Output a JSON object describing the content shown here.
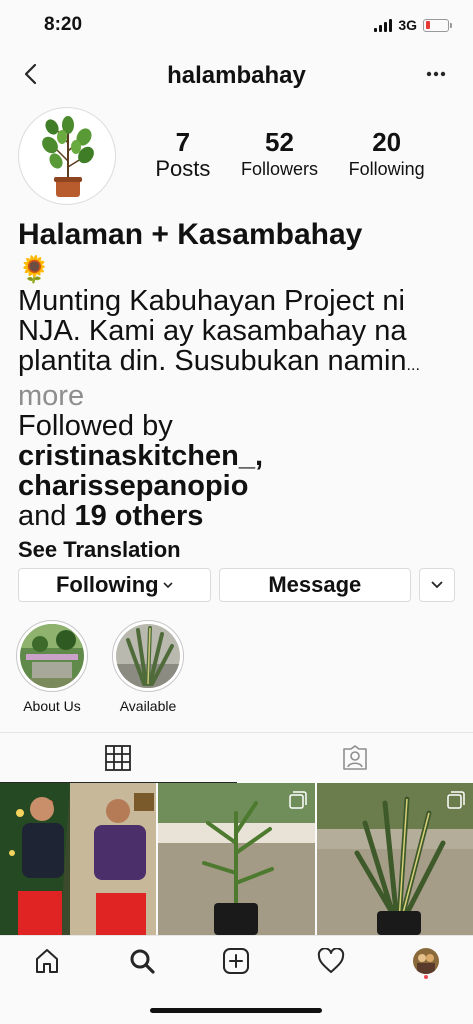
{
  "status_bar": {
    "time": "8:20",
    "network": "3G",
    "battery_level": 0.2
  },
  "header": {
    "username": "halambahay"
  },
  "profile": {
    "stats": [
      {
        "value": "7",
        "label": "Posts"
      },
      {
        "value": "52",
        "label": "Followers"
      },
      {
        "value": "20",
        "label": "Following"
      }
    ],
    "name": "Halaman + Kasambahay",
    "emoji": "🌻",
    "bio": "Munting Kabuhayan Project ni NJA. Kami ay kasambahay na plantita din. Susubukan namin",
    "ellipsis": "...",
    "more_label": " more",
    "followed_by_prefix": "Followed by",
    "followed_users": "cristinaskitchen_, charissepanopio",
    "followed_and": "and",
    "followed_others": "19 others",
    "see_translation": "See Translation"
  },
  "actions": {
    "following_label": "Following",
    "message_label": "Message"
  },
  "highlights": [
    {
      "label": "About Us"
    },
    {
      "label": "Available"
    }
  ],
  "colors": {
    "accent_red": "#ed4956",
    "border": "#dbdbdb",
    "muted": "#8e8e8e"
  }
}
